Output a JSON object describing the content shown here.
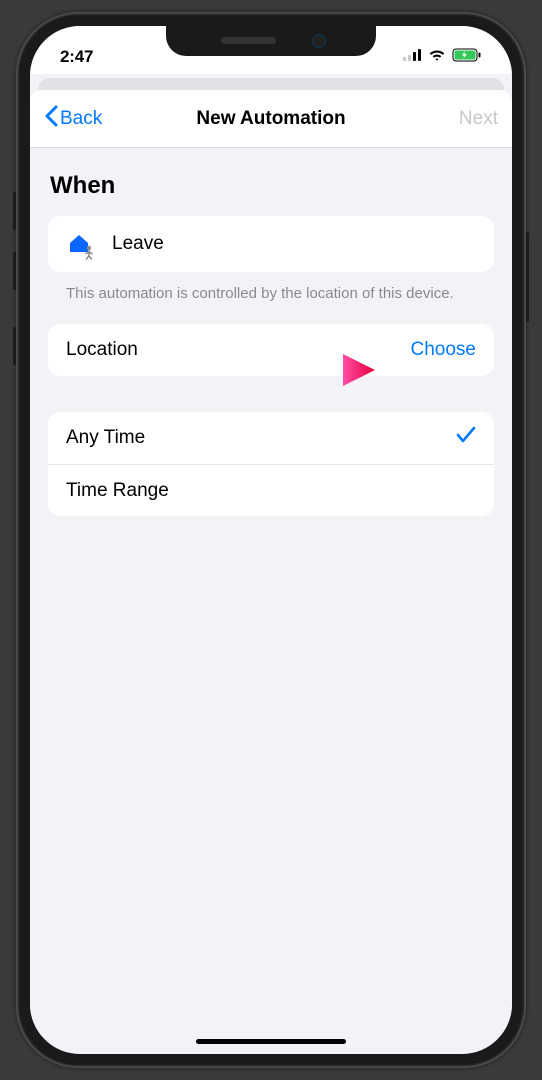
{
  "status_bar": {
    "time": "2:47"
  },
  "nav": {
    "back_label": "Back",
    "title": "New Automation",
    "next_label": "Next"
  },
  "section": {
    "title": "When"
  },
  "trigger": {
    "label": "Leave",
    "footnote": "This automation is controlled by the location of this device."
  },
  "location": {
    "label": "Location",
    "action": "Choose"
  },
  "time_options": {
    "any_time": "Any Time",
    "time_range": "Time Range"
  }
}
